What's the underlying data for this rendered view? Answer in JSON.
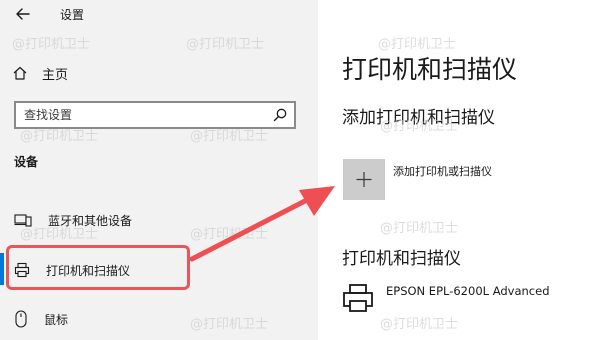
{
  "window": {
    "title": "设置"
  },
  "sidebar": {
    "home_label": "主页",
    "search_placeholder": "查找设置",
    "section_heading": "设备",
    "items": [
      {
        "label": "蓝牙和其他设备",
        "icon": "bluetooth-devices-icon",
        "selected": false
      },
      {
        "label": "打印机和扫描仪",
        "icon": "printer-icon",
        "selected": true
      },
      {
        "label": "鼠标",
        "icon": "mouse-icon",
        "selected": false
      }
    ]
  },
  "main": {
    "page_title": "打印机和扫描仪",
    "add_section_title": "添加打印机和扫描仪",
    "add_button_label": "添加打印机或扫描仪",
    "list_section_title": "打印机和扫描仪",
    "devices": [
      {
        "name": "EPSON EPL-6200L Advanced",
        "icon": "printer-icon"
      }
    ]
  },
  "watermark": "@打印机卫士",
  "colors": {
    "accent": "#0078d7",
    "highlight_box": "#e8555a",
    "arrow": "#ef4e53",
    "sidebar_bg": "#f2f2f2"
  }
}
